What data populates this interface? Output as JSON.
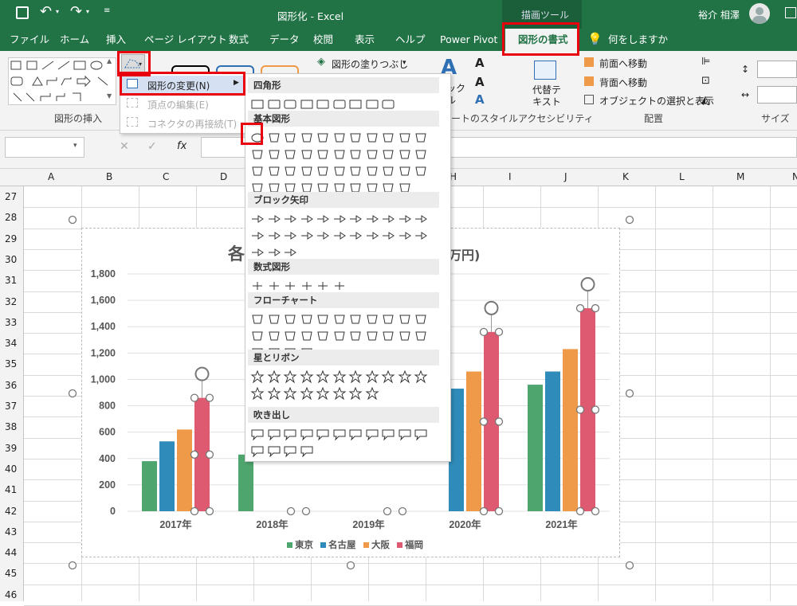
{
  "titlebar": {
    "title": "図形化 - Excel",
    "context_group": "描画ツール",
    "user": "裕介 相澤"
  },
  "tabs": [
    "ファイル",
    "ホーム",
    "挿入",
    "ページ レイアウト",
    "数式",
    "データ",
    "校閲",
    "表示",
    "ヘルプ",
    "Power Pivot",
    "図形の書式",
    "何をしますか"
  ],
  "ribbon": {
    "groups": [
      "図形の挿入",
      "ートのスタイル",
      "アクセシビリティ",
      "配置",
      "サイズ"
    ],
    "fill": "図形の塗りつぶし",
    "accessibility_label": "代替テ キスト",
    "wordart_partial": "ック ル",
    "arrange": [
      "前面へ移動",
      "背面へ移動",
      "オブジェクトの選択と表示"
    ]
  },
  "edit_menu": {
    "items": [
      {
        "label": "図形の変更(N)",
        "enabled": true
      },
      {
        "label": "頂点の編集(E)",
        "enabled": false
      },
      {
        "label": "コネクタの再接続(T)",
        "enabled": false
      }
    ]
  },
  "shape_gallery": {
    "sections": [
      "四角形",
      "基本図形",
      "ブロック矢印",
      "数式図形",
      "フローチャート",
      "星とリボン",
      "吹き出し"
    ]
  },
  "formula_bar": {
    "fx": "fx"
  },
  "sheet": {
    "columns": [
      "A",
      "B",
      "C",
      "D",
      "",
      "H",
      "I",
      "J",
      "K",
      "L",
      "M",
      "N"
    ],
    "rows": [
      "27",
      "28",
      "29",
      "30",
      "31",
      "32",
      "33",
      "34",
      "35",
      "36",
      "37",
      "38",
      "39",
      "40",
      "41",
      "42",
      "43",
      "44",
      "45",
      "46"
    ]
  },
  "chart_data": {
    "type": "bar",
    "title_left": "各",
    "title_right": "万円)",
    "categories": [
      "2017年",
      "2018年",
      "2019年",
      "2020年",
      "2021年"
    ],
    "ylim": [
      0,
      1800
    ],
    "yticks": [
      "0",
      "200",
      "400",
      "600",
      "800",
      "1,000",
      "1,200",
      "1,400",
      "1,600",
      "1,800"
    ],
    "series": [
      {
        "name": "東京",
        "color": "#4ea56e",
        "values": [
          380,
          430,
          null,
          null,
          960
        ]
      },
      {
        "name": "名古屋",
        "color": "#2f8cba",
        "values": [
          530,
          null,
          null,
          930,
          1060
        ]
      },
      {
        "name": "大阪",
        "color": "#ef9a48",
        "values": [
          620,
          null,
          null,
          1060,
          1230
        ]
      },
      {
        "name": "福岡",
        "color": "#dd5a70",
        "values": [
          860,
          null,
          null,
          1360,
          1540
        ]
      }
    ]
  }
}
